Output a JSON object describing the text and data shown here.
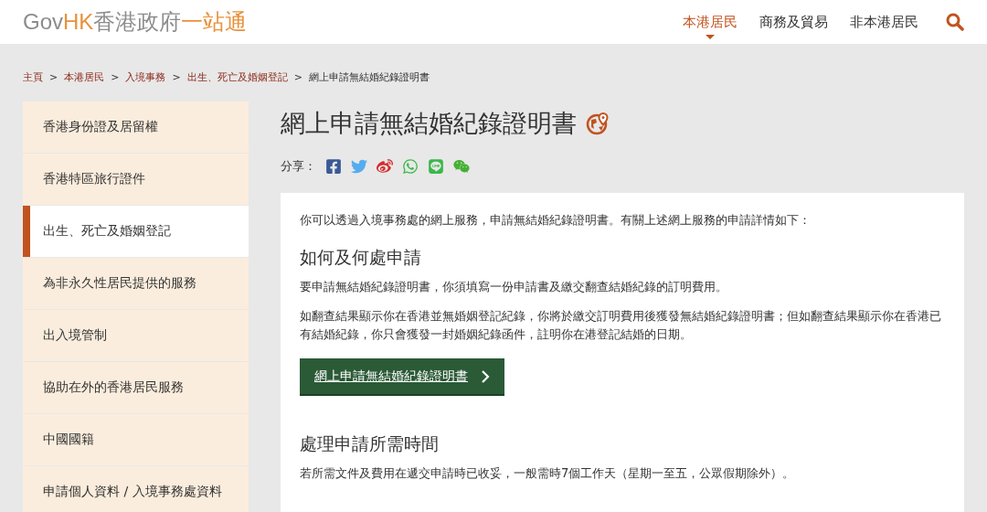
{
  "logo": {
    "gov": "Gov",
    "hk": "HK",
    "name": "香港政府",
    "tagline": "一站通"
  },
  "nav": [
    {
      "label": "本港居民",
      "selected": true
    },
    {
      "label": "商務及貿易",
      "selected": false
    },
    {
      "label": "非本港居民",
      "selected": false
    }
  ],
  "breadcrumb": [
    {
      "label": "主頁",
      "kind": "link"
    },
    {
      "label": "本港居民",
      "kind": "link"
    },
    {
      "label": "入境事務",
      "kind": "link"
    },
    {
      "label": "出生、死亡及婚姻登記",
      "kind": "link"
    },
    {
      "label": "網上申請無結婚紀錄證明書",
      "kind": "current"
    }
  ],
  "breadcrumb_separator": ">",
  "sidebar": {
    "items": [
      {
        "label": "香港身份證及居留權",
        "selected": false
      },
      {
        "label": "香港特區旅行證件",
        "selected": false
      },
      {
        "label": "出生、死亡及婚姻登記",
        "selected": true
      },
      {
        "label": "為非永久性居民提供的服務",
        "selected": false
      },
      {
        "label": "出入境管制",
        "selected": false
      },
      {
        "label": "協助在外的香港居民服務",
        "selected": false
      },
      {
        "label": "中國國籍",
        "selected": false
      },
      {
        "label": "申請個人資料 / 入境事務處資料",
        "selected": false
      }
    ]
  },
  "page_title": "網上申請無結婚紀錄證明書",
  "share": {
    "label": "分享：",
    "icons": [
      {
        "kind": "facebook"
      },
      {
        "kind": "twitter"
      },
      {
        "kind": "weibo"
      },
      {
        "kind": "whatsapp"
      },
      {
        "kind": "line"
      },
      {
        "kind": "wechat"
      }
    ]
  },
  "content": [
    {
      "kind": "paragraph",
      "text": "你可以透過入境事務處的網上服務，申請無結婚紀錄證明書。有關上述網上服務的申請詳情如下："
    },
    {
      "kind": "heading",
      "text": "如何及何處申請"
    },
    {
      "kind": "paragraph",
      "text": "要申請無結婚紀錄證明書，你須填寫一份申請書及繳交翻查結婚紀錄的訂明費用。"
    },
    {
      "kind": "paragraph",
      "text": "如翻查結果顯示你在香港並無婚姻登記紀錄，你將於繳交訂明費用後獲發無結婚紀錄證明書；但如翻查結果顯示你在香港已有結婚紀錄，你只會獲發一封婚姻紀錄函件，註明你在港登記結婚的日期。"
    },
    {
      "kind": "button",
      "text": "網上申請無結婚紀錄證明書"
    },
    {
      "kind": "heading",
      "text": "處理申請所需時間"
    },
    {
      "kind": "paragraph",
      "text": "若所需文件及費用在遞交申請時已收妥，一般需時7個工作天（星期一至五，公眾假期除外）。"
    }
  ]
}
